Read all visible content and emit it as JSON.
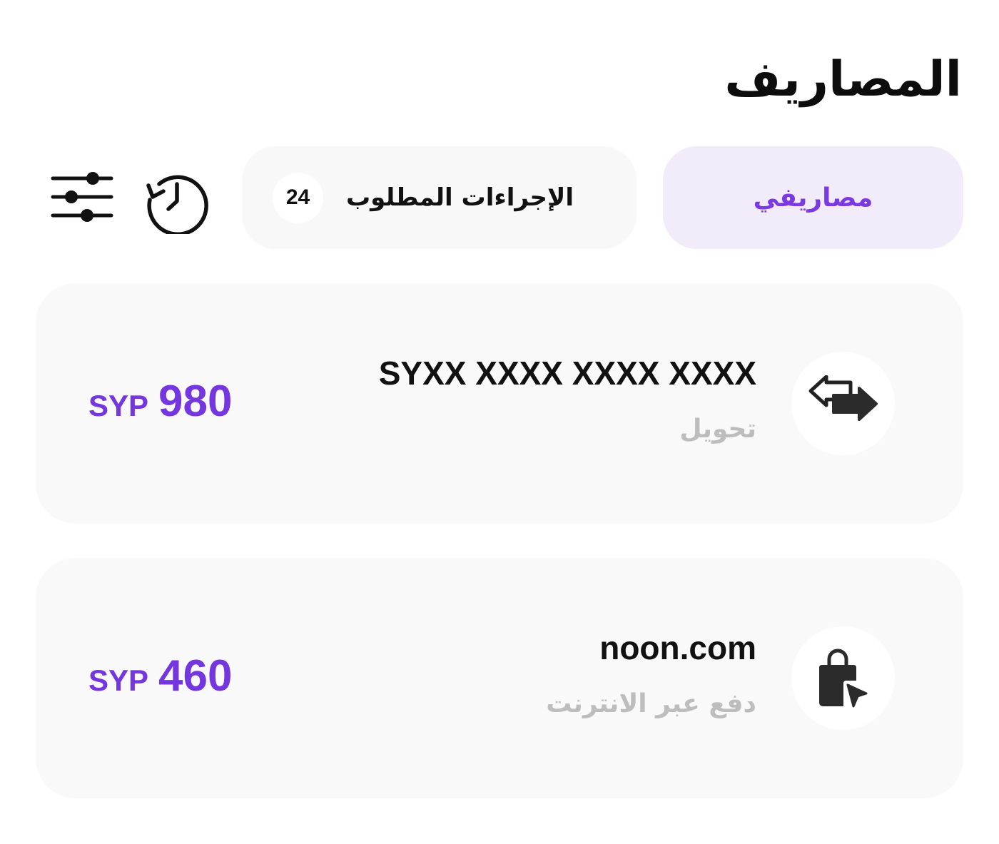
{
  "header": {
    "title": "المصاريف"
  },
  "tabs": {
    "my_expenses": "مصاريفي",
    "required_actions": {
      "label": "الإجراءات المطلوب",
      "count": "24"
    }
  },
  "toolbar": {
    "history_icon": "history-icon",
    "filter_icon": "sliders-icon"
  },
  "accent_color": "#7336df",
  "transactions": [
    {
      "title": "SYXX XXXX XXXX XXXX",
      "type": "تحويل",
      "icon": "transfer-icon",
      "currency": "SYP",
      "amount": "980"
    },
    {
      "title": "noon.com",
      "type": "دفع عبر الانترنت",
      "icon": "online-shopping-icon",
      "currency": "SYP",
      "amount": "460"
    }
  ]
}
